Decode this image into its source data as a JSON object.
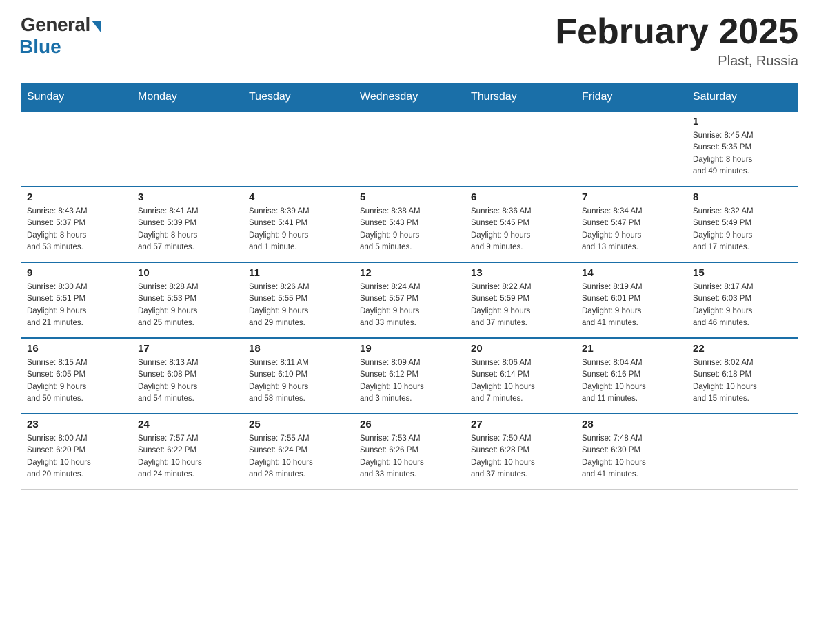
{
  "header": {
    "logo_general": "General",
    "logo_blue": "Blue",
    "month_title": "February 2025",
    "location": "Plast, Russia"
  },
  "days_of_week": [
    "Sunday",
    "Monday",
    "Tuesday",
    "Wednesday",
    "Thursday",
    "Friday",
    "Saturday"
  ],
  "weeks": [
    [
      {
        "day": "",
        "info": ""
      },
      {
        "day": "",
        "info": ""
      },
      {
        "day": "",
        "info": ""
      },
      {
        "day": "",
        "info": ""
      },
      {
        "day": "",
        "info": ""
      },
      {
        "day": "",
        "info": ""
      },
      {
        "day": "1",
        "info": "Sunrise: 8:45 AM\nSunset: 5:35 PM\nDaylight: 8 hours\nand 49 minutes."
      }
    ],
    [
      {
        "day": "2",
        "info": "Sunrise: 8:43 AM\nSunset: 5:37 PM\nDaylight: 8 hours\nand 53 minutes."
      },
      {
        "day": "3",
        "info": "Sunrise: 8:41 AM\nSunset: 5:39 PM\nDaylight: 8 hours\nand 57 minutes."
      },
      {
        "day": "4",
        "info": "Sunrise: 8:39 AM\nSunset: 5:41 PM\nDaylight: 9 hours\nand 1 minute."
      },
      {
        "day": "5",
        "info": "Sunrise: 8:38 AM\nSunset: 5:43 PM\nDaylight: 9 hours\nand 5 minutes."
      },
      {
        "day": "6",
        "info": "Sunrise: 8:36 AM\nSunset: 5:45 PM\nDaylight: 9 hours\nand 9 minutes."
      },
      {
        "day": "7",
        "info": "Sunrise: 8:34 AM\nSunset: 5:47 PM\nDaylight: 9 hours\nand 13 minutes."
      },
      {
        "day": "8",
        "info": "Sunrise: 8:32 AM\nSunset: 5:49 PM\nDaylight: 9 hours\nand 17 minutes."
      }
    ],
    [
      {
        "day": "9",
        "info": "Sunrise: 8:30 AM\nSunset: 5:51 PM\nDaylight: 9 hours\nand 21 minutes."
      },
      {
        "day": "10",
        "info": "Sunrise: 8:28 AM\nSunset: 5:53 PM\nDaylight: 9 hours\nand 25 minutes."
      },
      {
        "day": "11",
        "info": "Sunrise: 8:26 AM\nSunset: 5:55 PM\nDaylight: 9 hours\nand 29 minutes."
      },
      {
        "day": "12",
        "info": "Sunrise: 8:24 AM\nSunset: 5:57 PM\nDaylight: 9 hours\nand 33 minutes."
      },
      {
        "day": "13",
        "info": "Sunrise: 8:22 AM\nSunset: 5:59 PM\nDaylight: 9 hours\nand 37 minutes."
      },
      {
        "day": "14",
        "info": "Sunrise: 8:19 AM\nSunset: 6:01 PM\nDaylight: 9 hours\nand 41 minutes."
      },
      {
        "day": "15",
        "info": "Sunrise: 8:17 AM\nSunset: 6:03 PM\nDaylight: 9 hours\nand 46 minutes."
      }
    ],
    [
      {
        "day": "16",
        "info": "Sunrise: 8:15 AM\nSunset: 6:05 PM\nDaylight: 9 hours\nand 50 minutes."
      },
      {
        "day": "17",
        "info": "Sunrise: 8:13 AM\nSunset: 6:08 PM\nDaylight: 9 hours\nand 54 minutes."
      },
      {
        "day": "18",
        "info": "Sunrise: 8:11 AM\nSunset: 6:10 PM\nDaylight: 9 hours\nand 58 minutes."
      },
      {
        "day": "19",
        "info": "Sunrise: 8:09 AM\nSunset: 6:12 PM\nDaylight: 10 hours\nand 3 minutes."
      },
      {
        "day": "20",
        "info": "Sunrise: 8:06 AM\nSunset: 6:14 PM\nDaylight: 10 hours\nand 7 minutes."
      },
      {
        "day": "21",
        "info": "Sunrise: 8:04 AM\nSunset: 6:16 PM\nDaylight: 10 hours\nand 11 minutes."
      },
      {
        "day": "22",
        "info": "Sunrise: 8:02 AM\nSunset: 6:18 PM\nDaylight: 10 hours\nand 15 minutes."
      }
    ],
    [
      {
        "day": "23",
        "info": "Sunrise: 8:00 AM\nSunset: 6:20 PM\nDaylight: 10 hours\nand 20 minutes."
      },
      {
        "day": "24",
        "info": "Sunrise: 7:57 AM\nSunset: 6:22 PM\nDaylight: 10 hours\nand 24 minutes."
      },
      {
        "day": "25",
        "info": "Sunrise: 7:55 AM\nSunset: 6:24 PM\nDaylight: 10 hours\nand 28 minutes."
      },
      {
        "day": "26",
        "info": "Sunrise: 7:53 AM\nSunset: 6:26 PM\nDaylight: 10 hours\nand 33 minutes."
      },
      {
        "day": "27",
        "info": "Sunrise: 7:50 AM\nSunset: 6:28 PM\nDaylight: 10 hours\nand 37 minutes."
      },
      {
        "day": "28",
        "info": "Sunrise: 7:48 AM\nSunset: 6:30 PM\nDaylight: 10 hours\nand 41 minutes."
      },
      {
        "day": "",
        "info": ""
      }
    ]
  ]
}
